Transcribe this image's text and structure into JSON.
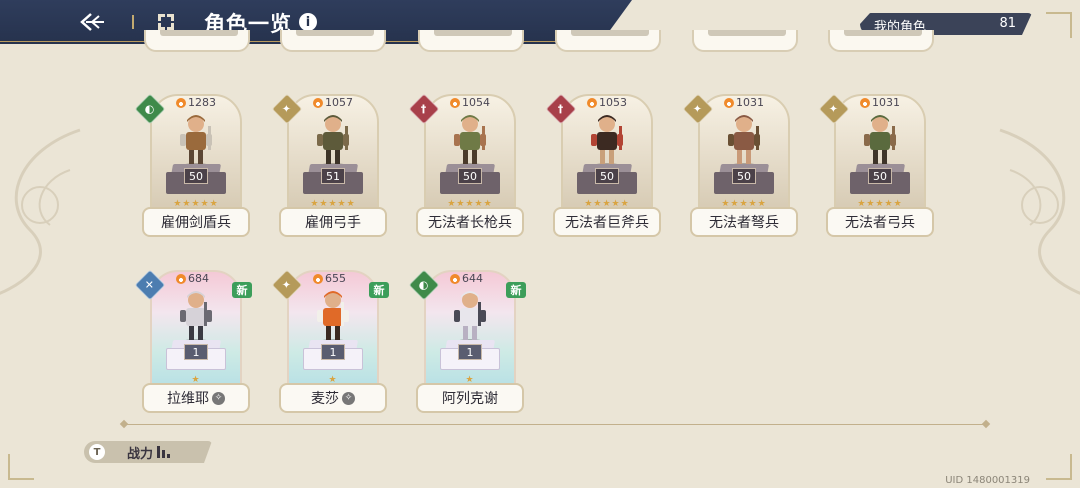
{
  "header": {
    "title": "角色一览",
    "info_glyph": "i"
  },
  "counter": {
    "label": "我的角色",
    "value": "81"
  },
  "cards_row1": [
    {
      "name": "雇佣剑盾兵",
      "power": "1283",
      "level": "50",
      "class": "shield",
      "class_color": "#3f8a4a",
      "glyph": "◐",
      "stars": "★★★★★",
      "palette": [
        "#9a6a3c",
        "#c9c2b6",
        "#5b4634"
      ]
    },
    {
      "name": "雇佣弓手",
      "power": "1057",
      "level": "51",
      "class": "star",
      "class_color": "#b59a5a",
      "glyph": "✦",
      "stars": "★★★★★",
      "palette": [
        "#5d5a3a",
        "#7b6a4a",
        "#3e3428"
      ]
    },
    {
      "name": "无法者长枪兵",
      "power": "1054",
      "level": "50",
      "class": "sword",
      "class_color": "#a8404a",
      "glyph": "†",
      "stars": "★★★★★",
      "palette": [
        "#6f7a46",
        "#a8734e",
        "#4a3a2a"
      ]
    },
    {
      "name": "无法者巨斧兵",
      "power": "1053",
      "level": "50",
      "class": "sword",
      "class_color": "#a8404a",
      "glyph": "†",
      "stars": "★★★★★",
      "palette": [
        "#3c2a22",
        "#b24434",
        "#c9a07a"
      ]
    },
    {
      "name": "无法者弩兵",
      "power": "1031",
      "level": "50",
      "class": "star",
      "class_color": "#b59a5a",
      "glyph": "✦",
      "stars": "★★★★★",
      "palette": [
        "#8a5a44",
        "#6a5034",
        "#c99a78"
      ]
    },
    {
      "name": "无法者弓兵",
      "power": "1031",
      "level": "50",
      "class": "star",
      "class_color": "#b59a5a",
      "glyph": "✦",
      "stars": "★★★★★",
      "palette": [
        "#5a6a3e",
        "#8a6a4a",
        "#3e3428"
      ]
    }
  ],
  "cards_row2": [
    {
      "name": "拉维耶",
      "power": "684",
      "level": "1",
      "class": "magic",
      "class_color": "#4c7db0",
      "glyph": "✕",
      "stars": "★",
      "new_label": "新",
      "awaken_glyph": "✧",
      "palette": [
        "#d6d2d8",
        "#6b6a72",
        "#3a3a42"
      ]
    },
    {
      "name": "麦莎",
      "power": "655",
      "level": "1",
      "class": "star",
      "class_color": "#b59a5a",
      "glyph": "✦",
      "stars": "★",
      "new_label": "新",
      "awaken_glyph": "✧",
      "palette": [
        "#e06a28",
        "#f2f0ea",
        "#3a2a22"
      ]
    },
    {
      "name": "阿列克谢",
      "power": "644",
      "level": "1",
      "class": "shield",
      "class_color": "#3f8a4a",
      "glyph": "◐",
      "stars": "★",
      "new_label": "新",
      "palette": [
        "#e8e6ec",
        "#4a4a56",
        "#b8b0c2"
      ]
    }
  ],
  "sort": {
    "label": "战力",
    "icon_glyph": "T"
  },
  "uid": "UID 1480001319",
  "icons": [
    "back-arrow-icon",
    "grid-icon",
    "info-icon",
    "flame-icon",
    "class-badge-icon",
    "sort-bars-icon"
  ]
}
